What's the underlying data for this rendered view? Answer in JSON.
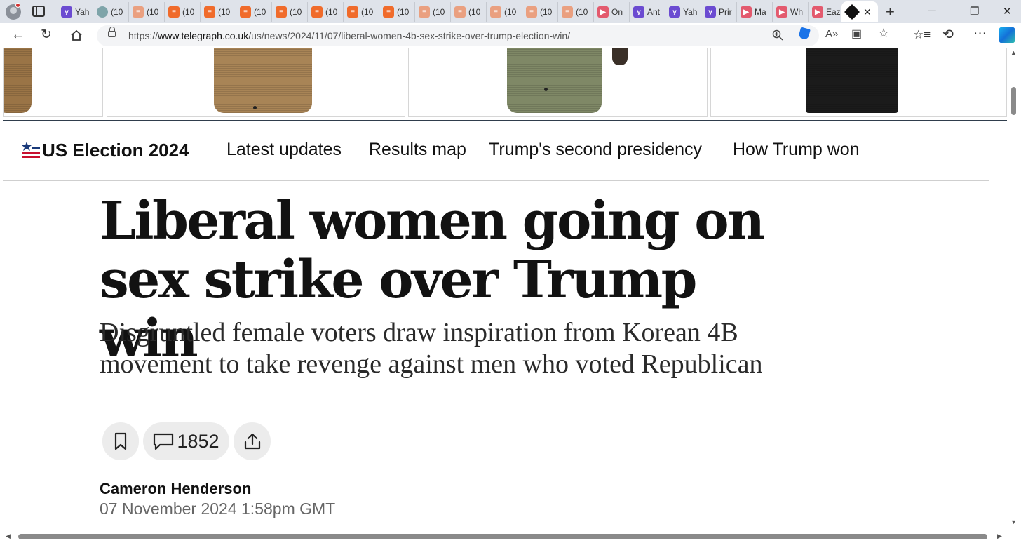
{
  "browser": {
    "tabs": [
      {
        "title": "",
        "favicon": "yahoo"
      },
      {
        "title": "Yah",
        "favicon": "yahoo"
      },
      {
        "title": "(10",
        "favicon": "globe"
      },
      {
        "title": "(10",
        "favicon": "substack"
      },
      {
        "title": "(10",
        "favicon": "substack-orange"
      },
      {
        "title": "(10",
        "favicon": "substack-orange"
      },
      {
        "title": "(10",
        "favicon": "substack-orange"
      },
      {
        "title": "(10",
        "favicon": "substack-orange"
      },
      {
        "title": "(10",
        "favicon": "substack-orange"
      },
      {
        "title": "(10",
        "favicon": "substack-orange"
      },
      {
        "title": "(10",
        "favicon": "substack-orange"
      },
      {
        "title": "(10",
        "favicon": "substack"
      },
      {
        "title": "(10",
        "favicon": "substack"
      },
      {
        "title": "(10",
        "favicon": "substack"
      },
      {
        "title": "(10",
        "favicon": "substack"
      },
      {
        "title": "(10",
        "favicon": "substack"
      },
      {
        "title": "On",
        "favicon": "youtube"
      },
      {
        "title": "Ant",
        "favicon": "yahoo"
      },
      {
        "title": "Yah",
        "favicon": "yahoo"
      },
      {
        "title": "Prir",
        "favicon": "yahoo"
      },
      {
        "title": "Ma",
        "favicon": "youtube"
      },
      {
        "title": "Wh",
        "favicon": "youtube"
      },
      {
        "title": "Eaz",
        "favicon": "youtube"
      }
    ],
    "url_prefix": "https://",
    "url_domain": "www.telegraph.co.uk",
    "url_path": "/us/news/2024/11/07/liberal-women-4b-sex-strike-over-trump-election-win/"
  },
  "election": {
    "title": "US Election 2024",
    "links": [
      "Latest updates",
      "Results map",
      "Trump's second presidency",
      "How Trump won"
    ]
  },
  "article": {
    "headline": "Liberal women going on sex strike over Trump win",
    "standfirst": "Disgruntled female voters draw inspiration from Korean 4B movement to take revenge against men who voted Republican",
    "comment_count": "1852",
    "author": "Cameron Henderson",
    "date": "07 November 2024 1:58pm GMT"
  },
  "colors": {
    "headline": "#121212",
    "tabstrip": "#dfe3ea",
    "accent_blue": "#1a73e8",
    "flag_red": "#c8102e",
    "flag_blue": "#1a3a7a"
  }
}
